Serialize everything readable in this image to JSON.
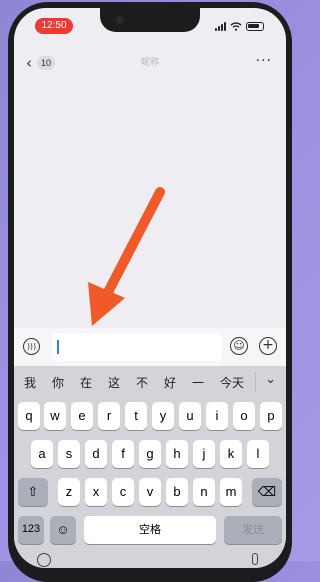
{
  "status_bar": {
    "time": "12:50"
  },
  "nav": {
    "back_icon": "chevron-left-icon",
    "unread_count": "10",
    "title": "昵称",
    "more_icon": "more-dots-icon"
  },
  "input_bar": {
    "voice_icon": "voice-icon",
    "emoji_icon": "emoji-icon",
    "plus_icon": "plus-icon",
    "value": ""
  },
  "candidates": [
    "我",
    "你",
    "在",
    "这",
    "不",
    "好",
    "一",
    "今天"
  ],
  "keyboard": {
    "row1": [
      "q",
      "w",
      "e",
      "r",
      "t",
      "y",
      "u",
      "i",
      "o",
      "p"
    ],
    "row2": [
      "a",
      "s",
      "d",
      "f",
      "g",
      "h",
      "j",
      "k",
      "l"
    ],
    "row3": [
      "z",
      "x",
      "c",
      "v",
      "b",
      "n",
      "m"
    ],
    "shift_label": "⇧",
    "delete_label": "⌫",
    "numbers_label": "123",
    "emoji_label": "☺",
    "space_label": "空格",
    "send_label": "发送"
  },
  "annotation": {
    "arrow_color": "#f05a28"
  },
  "colors": {
    "time_pill": "#ee3a32",
    "caret": "#2f7cf6"
  }
}
